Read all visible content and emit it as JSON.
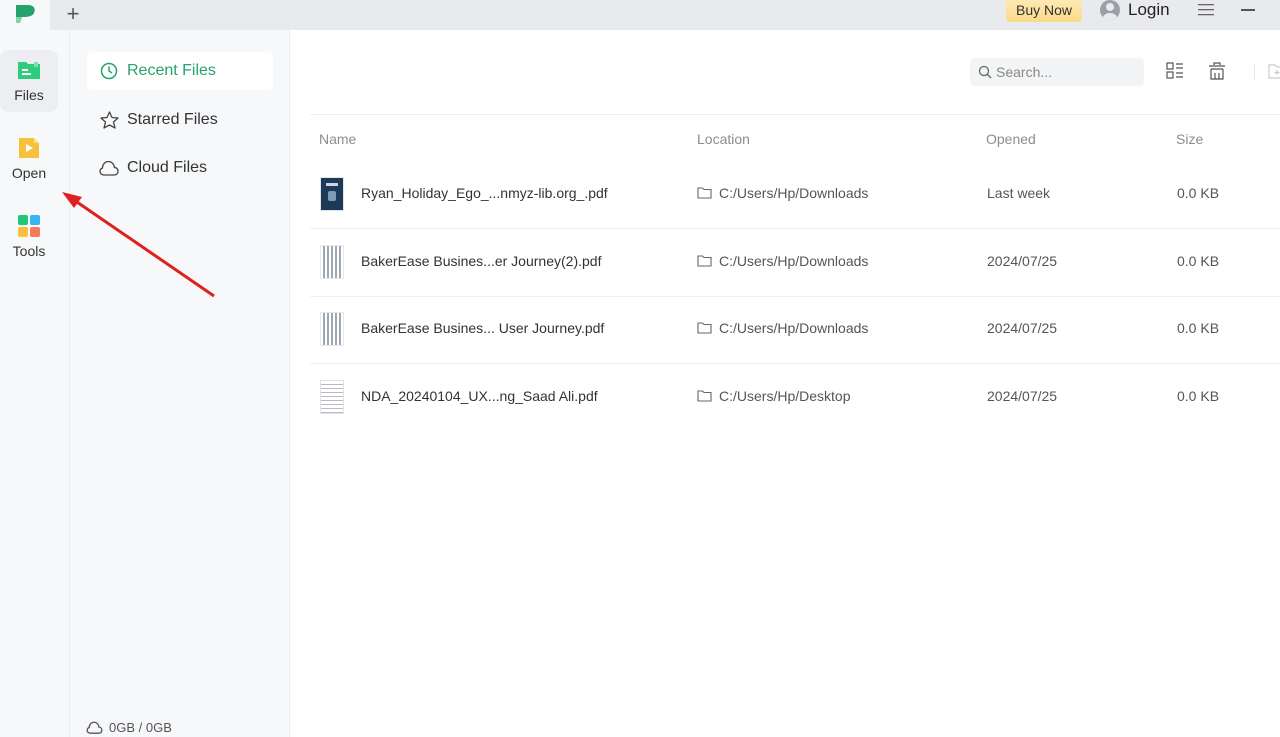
{
  "titlebar": {
    "new_tab_label": "+",
    "buy_now_label": "Buy Now",
    "login_label": "Login",
    "menu_icon": "☰"
  },
  "rail": {
    "items": [
      {
        "label": "Files",
        "icon": "folder-icon",
        "active": true
      },
      {
        "label": "Open",
        "icon": "open-file-icon",
        "active": false
      },
      {
        "label": "Tools",
        "icon": "tools-grid-icon",
        "active": false
      }
    ]
  },
  "sidebar": {
    "items": [
      {
        "label": "Recent Files",
        "icon": "clock-icon",
        "active": true
      },
      {
        "label": "Starred Files",
        "icon": "star-icon",
        "active": false
      },
      {
        "label": "Cloud Files",
        "icon": "cloud-icon",
        "active": false
      }
    ],
    "storage": "0GB / 0GB"
  },
  "toolbar": {
    "search_placeholder": "Search..."
  },
  "table": {
    "columns": [
      "Name",
      "Location",
      "Opened",
      "Size"
    ],
    "rows": [
      {
        "name": "Ryan_Holiday_Ego_...nmyz-lib.org_.pdf",
        "location": "C:/Users/Hp/Downloads",
        "opened": "Last week",
        "size": "0.0 KB",
        "thumb": "book-cover"
      },
      {
        "name": "BakerEase Busines...er Journey(2).pdf",
        "location": "C:/Users/Hp/Downloads",
        "opened": "2024/07/25",
        "size": "0.0 KB",
        "thumb": "grid-doc"
      },
      {
        "name": "BakerEase Busines... User Journey.pdf",
        "location": "C:/Users/Hp/Downloads",
        "opened": "2024/07/25",
        "size": "0.0 KB",
        "thumb": "grid-doc"
      },
      {
        "name": "NDA_20240104_UX...ng_Saad Ali.pdf",
        "location": "C:/Users/Hp/Desktop",
        "opened": "2024/07/25",
        "size": "0.0 KB",
        "thumb": "text-doc"
      }
    ]
  },
  "colors": {
    "accent": "#26a36c",
    "buy_now": "#fbd98a",
    "annotation_arrow": "#e02020"
  }
}
